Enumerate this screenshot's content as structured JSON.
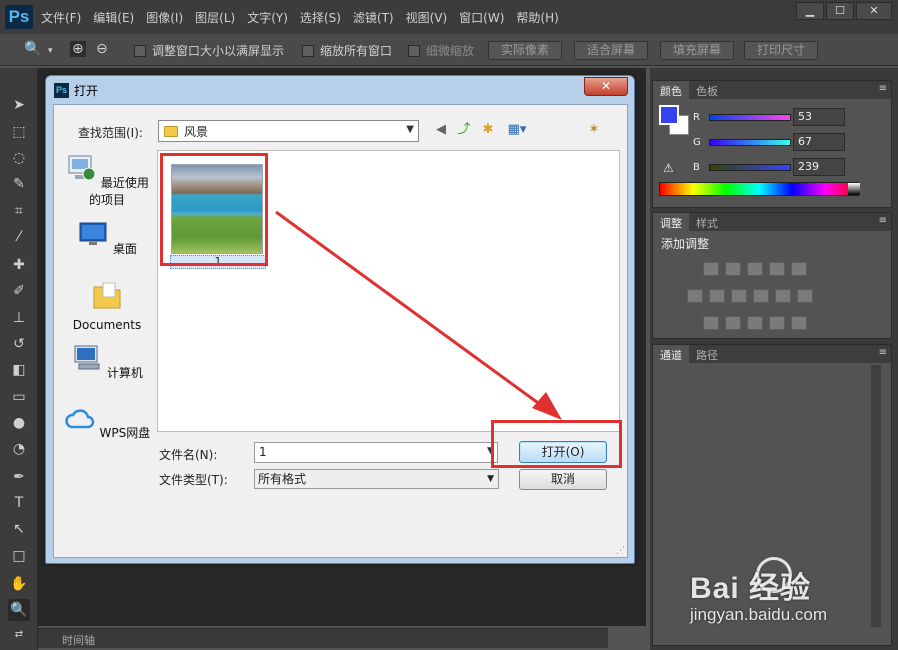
{
  "app": {
    "logo": "Ps",
    "menu": [
      "文件(F)",
      "编辑(E)",
      "图像(I)",
      "图层(L)",
      "文字(Y)",
      "选择(S)",
      "滤镜(T)",
      "视图(V)",
      "窗口(W)",
      "帮助(H)"
    ],
    "window_controls": {
      "minimize": "▁",
      "maximize": "☐",
      "close": "✕"
    }
  },
  "options_bar": {
    "checkbox_resize": "调整窗口大小以满屏显示",
    "checkbox_zoom_all": "缩放所有窗口",
    "checkbox_scrubby": "细微缩放",
    "btn_actual": "实际像素",
    "btn_fit": "适合屏幕",
    "btn_fill": "填充屏幕",
    "btn_print": "打印尺寸"
  },
  "panels": {
    "color_tabs": [
      "颜色",
      "色板"
    ],
    "rgb": [
      {
        "label": "R",
        "value": "53"
      },
      {
        "label": "G",
        "value": "67"
      },
      {
        "label": "B",
        "value": "239"
      }
    ],
    "foreground_color": "#3543ef",
    "adjust_tabs": [
      "调整",
      "样式"
    ],
    "adjust_title": "添加调整",
    "channel_tabs": [
      "通道",
      "路径"
    ]
  },
  "timeline": {
    "label": "时间轴"
  },
  "dialog": {
    "title": "打开",
    "close": "✕",
    "lookin_label": "查找范围(I):",
    "lookin_value": "风景",
    "places": [
      "最近使用的项目",
      "桌面",
      "Documents",
      "计算机",
      "WPS网盘"
    ],
    "files": [
      {
        "name": "1"
      }
    ],
    "filename_label": "文件名(N):",
    "filename_value": "1",
    "filetype_label": "文件类型(T):",
    "filetype_value": "所有格式",
    "open_button": "打开(O)",
    "cancel_button": "取消"
  },
  "watermark": {
    "main": "Bai  经验",
    "url": "jingyan.baidu.com"
  },
  "colors": {
    "annotation": "#e03030",
    "title_bar": "#b7cfe8"
  }
}
